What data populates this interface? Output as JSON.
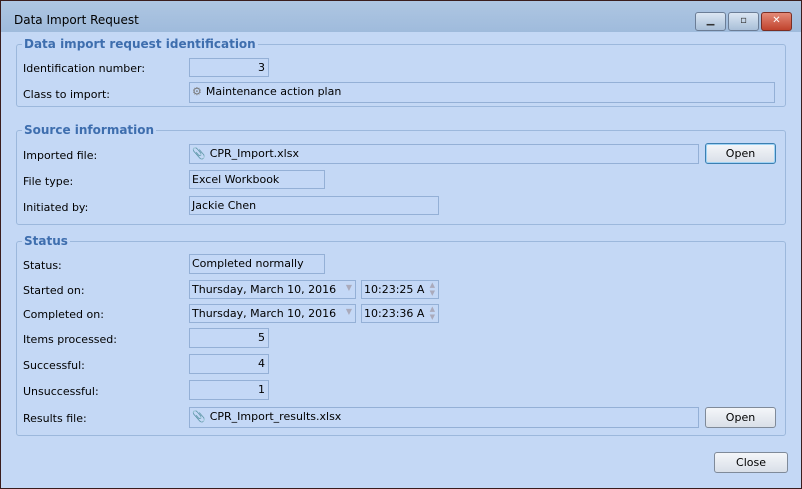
{
  "window": {
    "title": "Data Import Request",
    "minimize": "▁",
    "maximize": "▫",
    "close": "✕"
  },
  "group1": {
    "legend": "Data import request identification",
    "id_label": "Identification number:",
    "id_value": "3",
    "class_label": "Class to import:",
    "class_value": "Maintenance action plan"
  },
  "group2": {
    "legend": "Source information",
    "file_label": "Imported file:",
    "file_value": "CPR_Import.xlsx",
    "open_label": "Open",
    "type_label": "File type:",
    "type_value": "Excel Workbook",
    "init_label": "Initiated by:",
    "init_value": "Jackie Chen"
  },
  "group3": {
    "legend": "Status",
    "status_label": "Status:",
    "status_value": "Completed normally",
    "started_label": "Started on:",
    "started_date": "Thursday, March 10, 2016",
    "started_time": "10:23:25 A",
    "completed_label": "Completed on:",
    "completed_date": "Thursday, March 10, 2016",
    "completed_time": "10:23:36 A",
    "processed_label": "Items processed:",
    "processed_value": "5",
    "success_label": "Successful:",
    "success_value": "4",
    "unsuccess_label": "Unsuccessful:",
    "unsuccess_value": "1",
    "results_label": "Results file:",
    "results_value": "CPR_Import_results.xlsx",
    "open_label": "Open"
  },
  "footer": {
    "close_label": "Close"
  }
}
